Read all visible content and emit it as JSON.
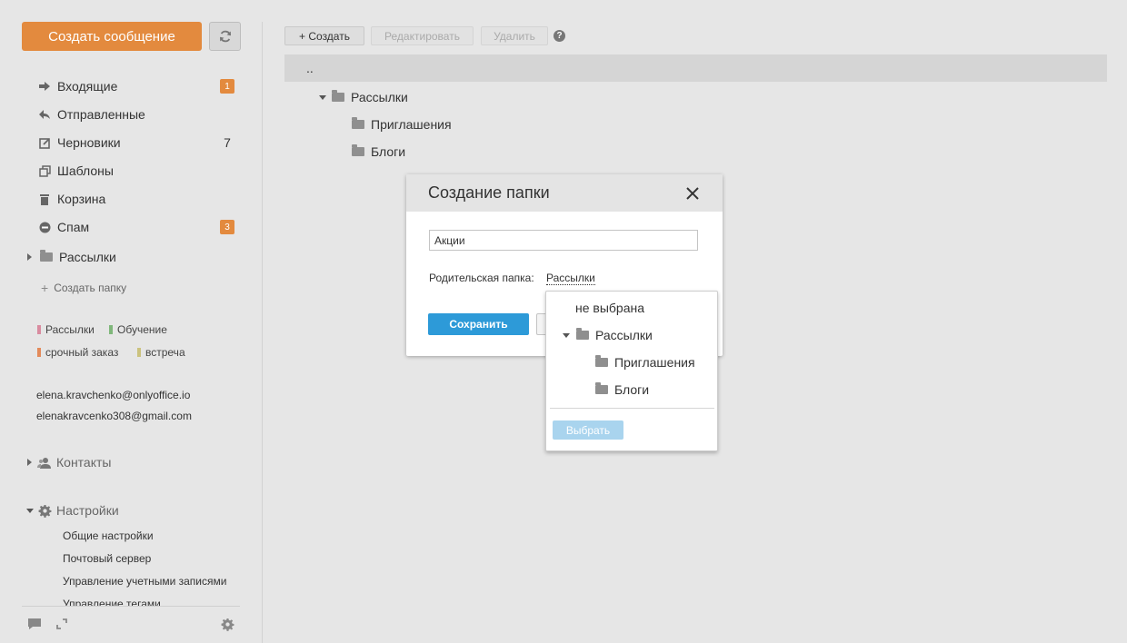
{
  "sidebar": {
    "create_message": "Создать сообщение",
    "folders": [
      {
        "label": "Входящие",
        "badge": "1"
      },
      {
        "label": "Отправленные"
      },
      {
        "label": "Черновики",
        "count": "7"
      },
      {
        "label": "Шаблоны"
      },
      {
        "label": "Корзина"
      },
      {
        "label": "Спам",
        "badge": "3"
      }
    ],
    "user_folder": "Рассылки",
    "create_folder": "Создать папку",
    "tags": [
      {
        "label": "Рассылки",
        "color": "#d98ca0"
      },
      {
        "label": "Обучение",
        "color": "#7fb77a"
      },
      {
        "label": "срочный заказ",
        "color": "#e38a5a"
      },
      {
        "label": "встреча",
        "color": "#cbc27e"
      }
    ],
    "accounts": [
      "elena.kravchenko@onlyoffice.io",
      "elenakravcenko308@gmail.com"
    ],
    "contacts": "Контакты",
    "settings": "Настройки",
    "settings_items": [
      "Общие настройки",
      "Почтовый сервер",
      "Управление учетными записями",
      "Управление тегами"
    ]
  },
  "toolbar": {
    "create": "+ Создать",
    "edit": "Редактировать",
    "delete": "Удалить",
    "help": "?"
  },
  "tree": {
    "up": "..",
    "root": "Рассылки",
    "children": [
      "Приглашения",
      "Блоги"
    ]
  },
  "modal": {
    "title": "Создание папки",
    "input_value": "Акции",
    "parent_label": "Родительская папка:",
    "parent_value": "Рассылки",
    "save": "Сохранить"
  },
  "dropdown": {
    "none": "не выбрана",
    "root": "Рассылки",
    "children": [
      "Приглашения",
      "Блоги"
    ],
    "select": "Выбрать"
  }
}
